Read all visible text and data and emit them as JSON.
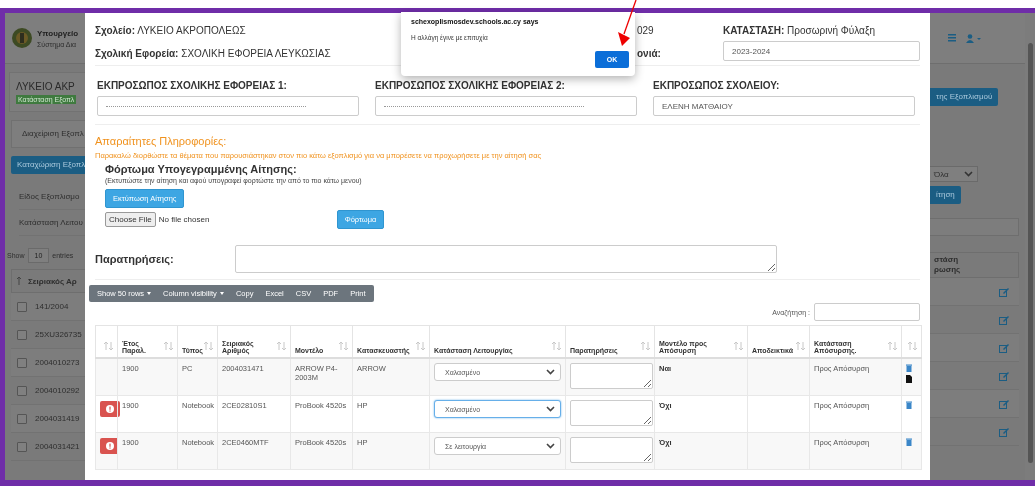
{
  "background_page": {
    "ministry": "Υπουργείο",
    "system": "Σύστημα Δια",
    "school_title": "ΛΥΚΕΙΟ ΑΚΡ",
    "status_badge": "Κατάσταση Εξοπλ",
    "tab": "Διαχείριση Εξοπλ",
    "add_button": "Καταχώριση Εξοπλ",
    "filters": [
      "Είδος Εξοπλισμο",
      "Κατάσταση Λειτου"
    ],
    "entries": {
      "prefix": "Show",
      "value": "10",
      "suffix": "entries"
    },
    "table": {
      "column": "Σειριακός Αρ",
      "rows": [
        {
          "serial": "141/2004",
          "checked": false
        },
        {
          "serial": "25XU326735",
          "checked": false
        },
        {
          "serial": "2004010273",
          "checked": false
        },
        {
          "serial": "2004010292",
          "checked": false
        },
        {
          "serial": "2004031419",
          "checked": false
        },
        {
          "serial": "2004031421",
          "checked": false
        }
      ]
    },
    "right": {
      "action_button": "της Εξοπλισμού",
      "filter_value": "Όλα",
      "submit_button": "ίτηση",
      "column_lines": [
        "στάση",
        "ρωσης"
      ]
    }
  },
  "modal": {
    "school": {
      "label": "Σχολείο:",
      "value": "ΛΥΚΕΙΟ ΑΚΡΟΠΟΛΕΩΣ"
    },
    "board": {
      "label": "Σχολική Εφορεία:",
      "value": "ΣΧΟΛΙΚΗ ΕΦΟΡΕΙΑ ΛΕΥΚΩΣΙΑΣ"
    },
    "code_fragment": "029",
    "year_label_fragment": "ονιά:",
    "status": {
      "label": "ΚΑΤΑΣΤΑΣΗ:",
      "value": "Προσωρινή Φύλαξη"
    },
    "school_year": "2023-2024",
    "representatives": [
      {
        "label": "ΕΚΠΡΟΣΩΠΟΣ ΣΧΟΛΙΚΗΣ ΕΦΟΡΕΙΑΣ 1:",
        "kind": "blank"
      },
      {
        "label": "ΕΚΠΡΟΣΩΠΟΣ ΣΧΟΛΙΚΗΣ ΕΦΟΡΕΙΑΣ 2:",
        "kind": "blank"
      },
      {
        "label": "ΕΚΠΡΟΣΩΠΟΣ ΣΧΟΛΕΙΟΥ:",
        "kind": "filled",
        "value": "ΕΛΕΝΗ ΜΑΤΘΑΙΟΥ"
      }
    ],
    "notice": {
      "title": "Απαραίτητες Πληροφορίες:",
      "text": "Παρακαλώ διορθώστε τα θέματα που παρουσιάστηκαν στον πιο κάτω εξοπλισμό για να μπορέσετε να προχωρήσετε με την αίτησή σας"
    },
    "upload": {
      "title": "Φόρτωμα Υπογεγραμμένης Αίτησης:",
      "hint": "(Εκτυπώστε την αίτηση και αφού υπογραφεί φορτώστε την από το πιο κάτω μενου)",
      "print_button": "Εκτύπωση Αίτησης",
      "file_button": "Choose File",
      "file_status": "No file chosen",
      "upload_button": "Φόρτωμα"
    },
    "remarks_label": "Παρατηρήσεις:",
    "toolbar": [
      {
        "label": "Show 50 rows",
        "dropdown": true
      },
      {
        "label": "Column visibility",
        "dropdown": true
      },
      {
        "label": "Copy",
        "dropdown": false
      },
      {
        "label": "Excel",
        "dropdown": false
      },
      {
        "label": "CSV",
        "dropdown": false
      },
      {
        "label": "PDF",
        "dropdown": false
      },
      {
        "label": "Print",
        "dropdown": false
      }
    ],
    "search_label": "Αναζήτηση :",
    "table": {
      "columns": [
        "Έτος Παραλ.",
        "Τύπος",
        "Σειριακός Αριθμός",
        "Μοντέλο",
        "Κατασκευαστής",
        "Κατάσταση Λειτουργίας",
        "Παρατηρήσεις",
        "Μοντέλο προς Απόσυρση",
        "Αποδεικτικά",
        "Κατάσταση Απόσυρσης."
      ],
      "rows": [
        {
          "warning": false,
          "year": "1900",
          "type": "PC",
          "serial": "2004031471",
          "model": "ARROW P4-2003M",
          "maker": "ARROW",
          "status": "Χαλασμένο",
          "focused": false,
          "withdraw_model": "Ναι",
          "withdraw_status": "Προς Απόσυρση",
          "has_file": true
        },
        {
          "warning": true,
          "year": "1900",
          "type": "Notebook",
          "serial": "2CE02810S1",
          "model": "ProBook 4520s",
          "maker": "HP",
          "status": "Χαλασμένο",
          "focused": true,
          "withdraw_model": "Όχι",
          "withdraw_status": "Προς Απόσυρση",
          "has_file": false
        },
        {
          "warning": true,
          "year": "1900",
          "type": "Notebook",
          "serial": "2CE0460MTF",
          "model": "ProBook 4520s",
          "maker": "HP",
          "status": "Σε λειτουργία",
          "focused": false,
          "withdraw_model": "Όχι",
          "withdraw_status": "Προς Απόσυρση",
          "has_file": false
        }
      ]
    }
  },
  "alert": {
    "origin": "schexoplismosdev.schools.ac.cy says",
    "message": "Η αλλάγη έγινε με επιτυχία",
    "button": "OK"
  },
  "annotation_arrow": true
}
